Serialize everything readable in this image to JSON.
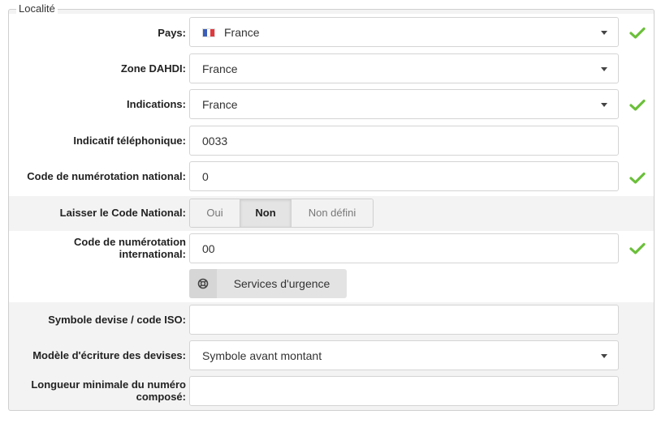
{
  "fieldset": {
    "legend": "Localité"
  },
  "fields": {
    "pays": {
      "label": "Pays:",
      "value": "France",
      "flag_colors": [
        "#3a5db8",
        "#ffffff",
        "#e0393e"
      ]
    },
    "zone_dahdi": {
      "label": "Zone DAHDI:",
      "value": "France"
    },
    "indications": {
      "label": "Indications:",
      "value": "France"
    },
    "indicatif": {
      "label": "Indicatif téléphonique:",
      "value": "0033"
    },
    "code_national": {
      "label": "Code de numérotation national:",
      "value": "0"
    },
    "laisser_code": {
      "label": "Laisser le Code National:",
      "options": [
        "Oui",
        "Non",
        "Non défini"
      ],
      "selected": "Non"
    },
    "code_international": {
      "label_line1": "Code de numérotation",
      "label_line2": "international:",
      "value": "00"
    },
    "emergency": {
      "label": "Services d'urgence"
    },
    "symbole_devise": {
      "label": "Symbole devise / code ISO:",
      "value": ""
    },
    "modele_devise": {
      "label": "Modèle d'écriture des devises:",
      "value": "Symbole avant montant"
    },
    "longueur_min": {
      "label_line1": "Longueur minimale du numéro",
      "label_line2": "composé:",
      "value": ""
    }
  },
  "colors": {
    "check_green": "#6bbf3a"
  }
}
